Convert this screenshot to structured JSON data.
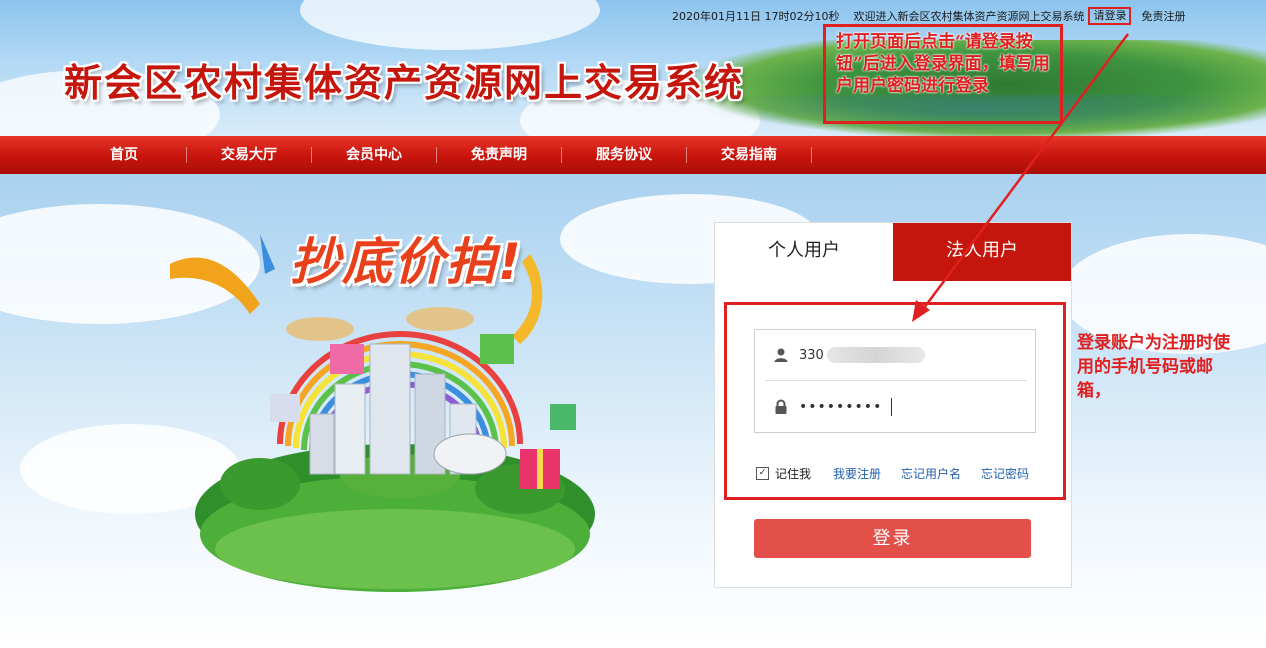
{
  "topbar": {
    "datetime": "2020年01月11日 17时02分10秒",
    "welcome": "欢迎进入新会区农村集体资产资源网上交易系统",
    "login_link": "请登录",
    "register_link": "免责注册"
  },
  "site": {
    "title": "新会区农村集体资产资源网上交易系统"
  },
  "nav": {
    "items": [
      {
        "label": "首页"
      },
      {
        "label": "交易大厅"
      },
      {
        "label": "会员中心"
      },
      {
        "label": "免责声明"
      },
      {
        "label": "服务协议"
      },
      {
        "label": "交易指南"
      }
    ]
  },
  "promo": {
    "title": "抄底价拍!"
  },
  "login": {
    "tabs": [
      {
        "label": "个人用户",
        "active": true
      },
      {
        "label": "法人用户",
        "active": false
      }
    ],
    "username_value": "330",
    "password_value": "•••••••••",
    "remember_label": "记住我",
    "remember_checked": true,
    "links": [
      {
        "label": "我要注册"
      },
      {
        "label": "忘记用户名"
      },
      {
        "label": "忘记密码"
      }
    ],
    "submit_label": "登录"
  },
  "annotations": {
    "top_note": "打开页面后点击“请登录按钮”后进入登录界面，填写用户用户密码进行登录",
    "right_note": "登录账户为注册时使用的手机号码或邮箱，"
  },
  "icons": [
    "user-icon",
    "lock-icon",
    "checkbox-checked-icon"
  ],
  "colors": {
    "brand_red": "#c4160c",
    "button_red": "#e3504a",
    "annotation_red": "#e02020",
    "link_blue": "#1f5fad"
  }
}
